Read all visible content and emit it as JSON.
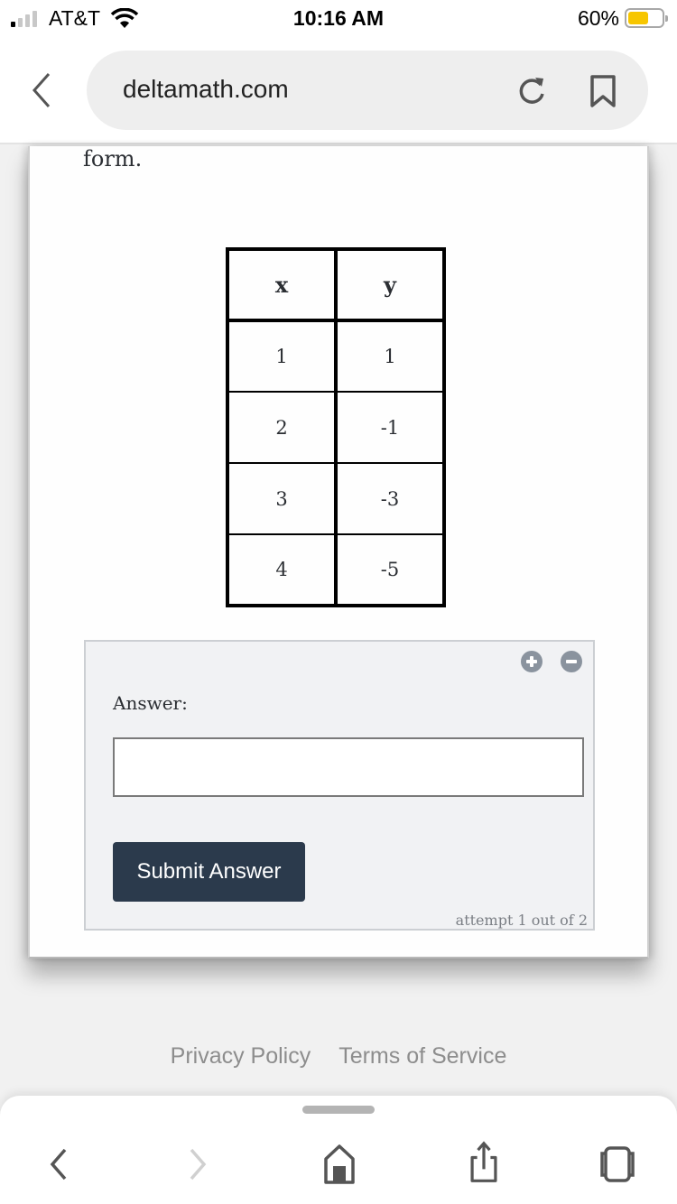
{
  "status_bar": {
    "carrier": "AT&T",
    "time": "10:16 AM",
    "battery_percent": "60%",
    "battery_level": 0.6,
    "signal_bars": 1
  },
  "browser": {
    "url": "deltamath.com"
  },
  "question": {
    "prompt_tail": "form.",
    "table": {
      "headers": [
        "x",
        "y"
      ],
      "rows": [
        [
          "1",
          "1"
        ],
        [
          "2",
          "-1"
        ],
        [
          "3",
          "-3"
        ],
        [
          "4",
          "-5"
        ]
      ]
    }
  },
  "answer_panel": {
    "label": "Answer:",
    "input_value": "",
    "submit_label": "Submit Answer",
    "attempt_text": "attempt 1 out of 2"
  },
  "footer": {
    "privacy_label": "Privacy Policy",
    "terms_label": "Terms of Service"
  },
  "colors": {
    "submit_bg": "#2b3a4c",
    "battery_fill": "#f7c600",
    "control_icon": "#8a939e"
  }
}
